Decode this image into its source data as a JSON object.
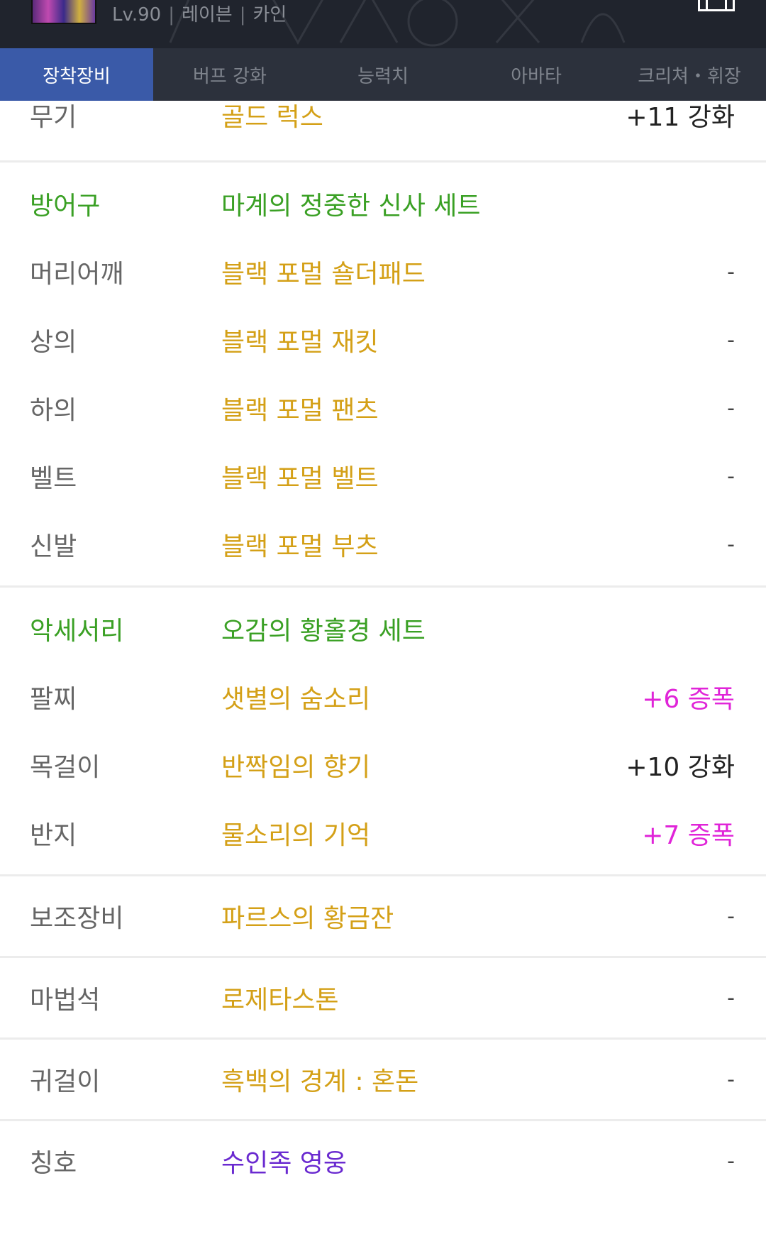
{
  "header": {
    "level": "Lv.90",
    "job": "레이븐",
    "server": "카인",
    "separator": "|"
  },
  "tabs": [
    {
      "label": "장착장비",
      "active": true
    },
    {
      "label": "버프 강화"
    },
    {
      "label": "능력치"
    },
    {
      "label": "아바타"
    },
    {
      "label": "크리쳐・휘장"
    }
  ],
  "weapon": {
    "category": "무기",
    "name": "골드 럭스",
    "value": "+11 강화"
  },
  "armor": {
    "set_category": "방어구",
    "set_name": "마계의 정중한 신사 세트",
    "items": [
      {
        "category": "머리어깨",
        "name": "블랙 포멀 숄더패드",
        "value": "-"
      },
      {
        "category": "상의",
        "name": "블랙 포멀 재킷",
        "value": "-"
      },
      {
        "category": "하의",
        "name": "블랙 포멀 팬츠",
        "value": "-"
      },
      {
        "category": "벨트",
        "name": "블랙 포멀 벨트",
        "value": "-"
      },
      {
        "category": "신발",
        "name": "블랙 포멀 부츠",
        "value": "-"
      }
    ]
  },
  "accessory": {
    "set_category": "악세서리",
    "set_name": "오감의 황홀경 세트",
    "items": [
      {
        "category": "팔찌",
        "name": "샛별의 숨소리",
        "value": "+6 증폭"
      },
      {
        "category": "목걸이",
        "name": "반짝임의 향기",
        "value": "+10 강화"
      },
      {
        "category": "반지",
        "name": "물소리의 기억",
        "value": "+7 증폭"
      }
    ]
  },
  "sub": {
    "category": "보조장비",
    "name": "파르스의 황금잔",
    "value": "-"
  },
  "magicstone": {
    "category": "마법석",
    "name": "로제타스톤",
    "value": "-"
  },
  "earring": {
    "category": "귀걸이",
    "name": "흑백의 경계 : 혼돈",
    "value": "-"
  },
  "title": {
    "category": "칭호",
    "name": "수인족 영웅",
    "value": "-"
  },
  "colors": {
    "header_bg": "#20242d",
    "tab_bg": "#2c313c",
    "tab_active": "#3a5aa8",
    "set_green": "#3aa024",
    "item_gold": "#d4a017",
    "amplify_magenta": "#e024d8",
    "title_purple": "#6a2ad0"
  }
}
